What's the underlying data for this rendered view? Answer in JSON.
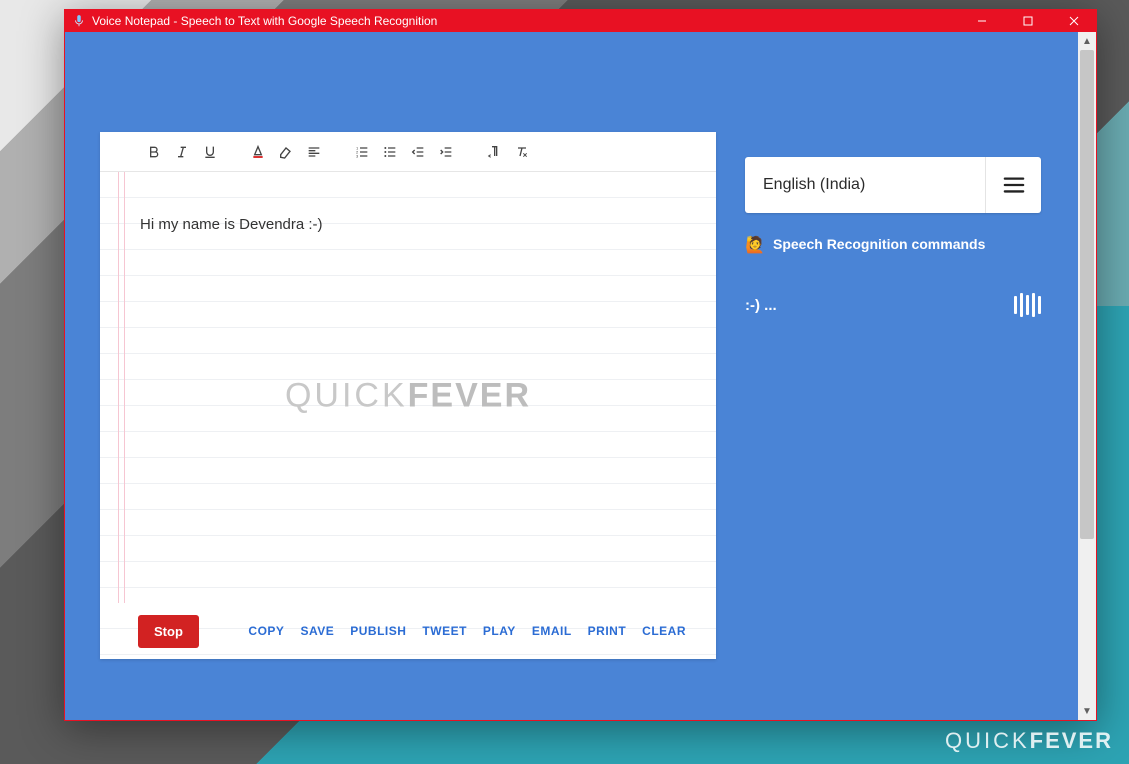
{
  "window": {
    "title": "Voice Notepad - Speech to Text with Google Speech Recognition"
  },
  "editor": {
    "text": "Hi my name is Devendra  :-)"
  },
  "watermark": {
    "part1": "QUICK",
    "part2": "FEVER"
  },
  "buttons": {
    "stop": "Stop"
  },
  "actions": {
    "copy": "COPY",
    "save": "SAVE",
    "publish": "PUBLISH",
    "tweet": "TWEET",
    "play": "PLAY",
    "email": "EMAIL",
    "print": "PRINT",
    "clear": "CLEAR"
  },
  "side": {
    "language": "English (India)",
    "commands_label": "Speech Recognition commands",
    "status": ":-) ..."
  },
  "footer": {
    "part1": "QUICK",
    "part2": "FEVER"
  }
}
